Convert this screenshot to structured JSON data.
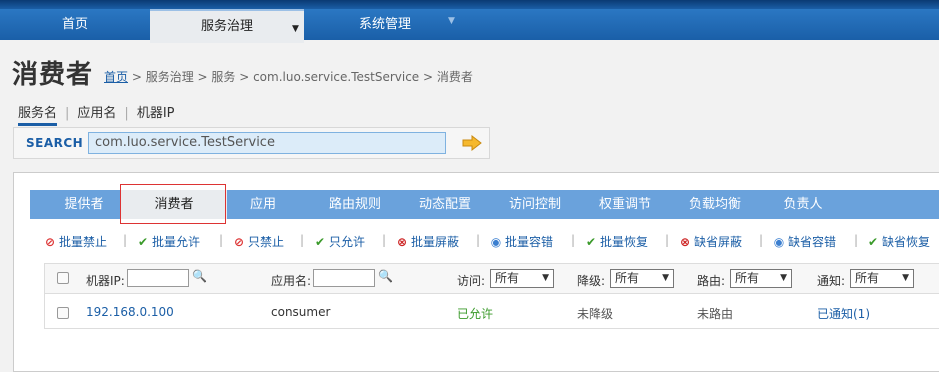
{
  "nav": {
    "items": [
      {
        "label": "首页"
      },
      {
        "label": "服务治理",
        "caret": "▼"
      },
      {
        "label": "系统管理",
        "caret": "▼"
      }
    ]
  },
  "header": {
    "title": "消费者",
    "breadcrumb": {
      "home": "首页",
      "rest": " > 服务治理 > 服务 > com.luo.service.TestService > 消费者"
    }
  },
  "search_tabs": [
    "服务名",
    "应用名",
    "机器IP"
  ],
  "search": {
    "label": "SEARCH",
    "value": "com.luo.service.TestService",
    "go_icon": "arrow-right-icon"
  },
  "tabs": [
    "提供者",
    "消费者",
    "应用",
    "路由规则",
    "动态配置",
    "访问控制",
    "权重调节",
    "负载均衡",
    "负责人"
  ],
  "toolbar": {
    "buttons": [
      {
        "label": "批量禁止",
        "icon": "ban-icon"
      },
      {
        "label": "批量允许",
        "icon": "check-icon"
      },
      {
        "label": "只禁止",
        "icon": "ban-icon"
      },
      {
        "label": "只允许",
        "icon": "check-icon"
      },
      {
        "label": "批量屏蔽",
        "icon": "x-circle-icon"
      },
      {
        "label": "批量容错",
        "icon": "dot-circle-icon"
      },
      {
        "label": "批量恢复",
        "icon": "check-icon"
      },
      {
        "label": "缺省屏蔽",
        "icon": "x-circle-icon"
      },
      {
        "label": "缺省容错",
        "icon": "dot-circle-icon"
      },
      {
        "label": "缺省恢复",
        "icon": "check-icon"
      }
    ]
  },
  "table": {
    "headers": {
      "ip": "机器IP:",
      "app": "应用名:",
      "access": "访问:",
      "access_value": "所有",
      "degrade": "降级:",
      "degrade_value": "所有",
      "route": "路由:",
      "route_value": "所有",
      "notify": "通知:",
      "notify_value": "所有"
    },
    "rows": [
      {
        "ip": "192.168.0.100",
        "app": "consumer",
        "access": "已允许",
        "degrade": "未降级",
        "route": "未路由",
        "notify": "已通知(1)"
      }
    ]
  },
  "colors": {
    "nav": "#1a5fa8",
    "tabbar": "#6aa2dc",
    "link": "#1b5ea6",
    "allowed": "#3a9a2a"
  }
}
